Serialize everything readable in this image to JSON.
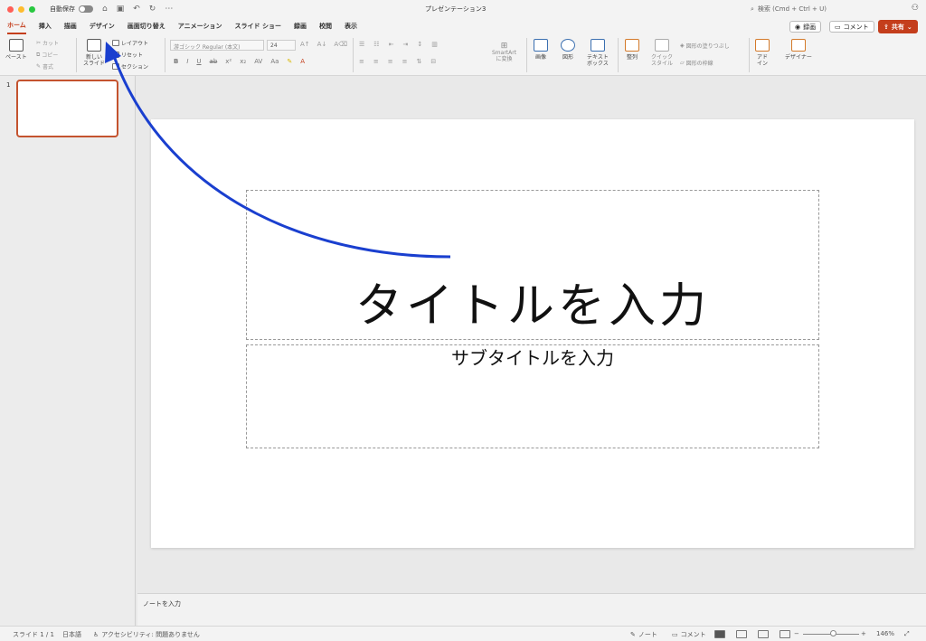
{
  "window": {
    "autosave_label": "自動保存",
    "title": "プレゼンテーション3",
    "search_placeholder": "検索 (Cmd + Ctrl + U)"
  },
  "tabs": [
    {
      "label": "ホーム",
      "active": true
    },
    {
      "label": "挿入"
    },
    {
      "label": "描画"
    },
    {
      "label": "デザイン"
    },
    {
      "label": "画面切り替え"
    },
    {
      "label": "アニメーション"
    },
    {
      "label": "スライド ショー"
    },
    {
      "label": "録画"
    },
    {
      "label": "校閲"
    },
    {
      "label": "表示"
    }
  ],
  "header_buttons": {
    "record": "録画",
    "comment": "コメント",
    "share": "共有"
  },
  "ribbon": {
    "paste": "ペースト",
    "cut": "カット",
    "copy": "コピー",
    "format": "書式",
    "new_slide_line1": "新しい",
    "new_slide_line2": "スライド",
    "layout": "レイアウト",
    "reset": "リセット",
    "section": "セクション",
    "font_name": "游ゴシック Regular (本文)",
    "font_size": "24",
    "smartart_line1": "SmartArt",
    "smartart_line2": "に変換",
    "picture": "画像",
    "shapes": "図形",
    "textbox_line1": "テキスト",
    "textbox_line2": "ボックス",
    "arrange": "整列",
    "quick_styles_line1": "クイック",
    "quick_styles_line2": "スタイル",
    "shape_fill": "図形の塗りつぶし",
    "shape_outline": "図形の枠線",
    "addins_line1": "アド",
    "addins_line2": "イン",
    "designer": "デザイナー"
  },
  "thumbnails": [
    {
      "number": "1"
    }
  ],
  "slide": {
    "title_placeholder": "タイトルを入力",
    "subtitle_placeholder": "サブタイトルを入力"
  },
  "notes_placeholder": "ノートを入力",
  "status": {
    "slide_count": "スライド 1 / 1",
    "language": "日本語",
    "accessibility": "アクセシビリティ: 問題ありません",
    "notes": "ノート",
    "comments": "コメント",
    "zoom": "146%"
  },
  "colors": {
    "accent": "#c43e1c",
    "annotation_arrow": "#1a3fcf"
  }
}
